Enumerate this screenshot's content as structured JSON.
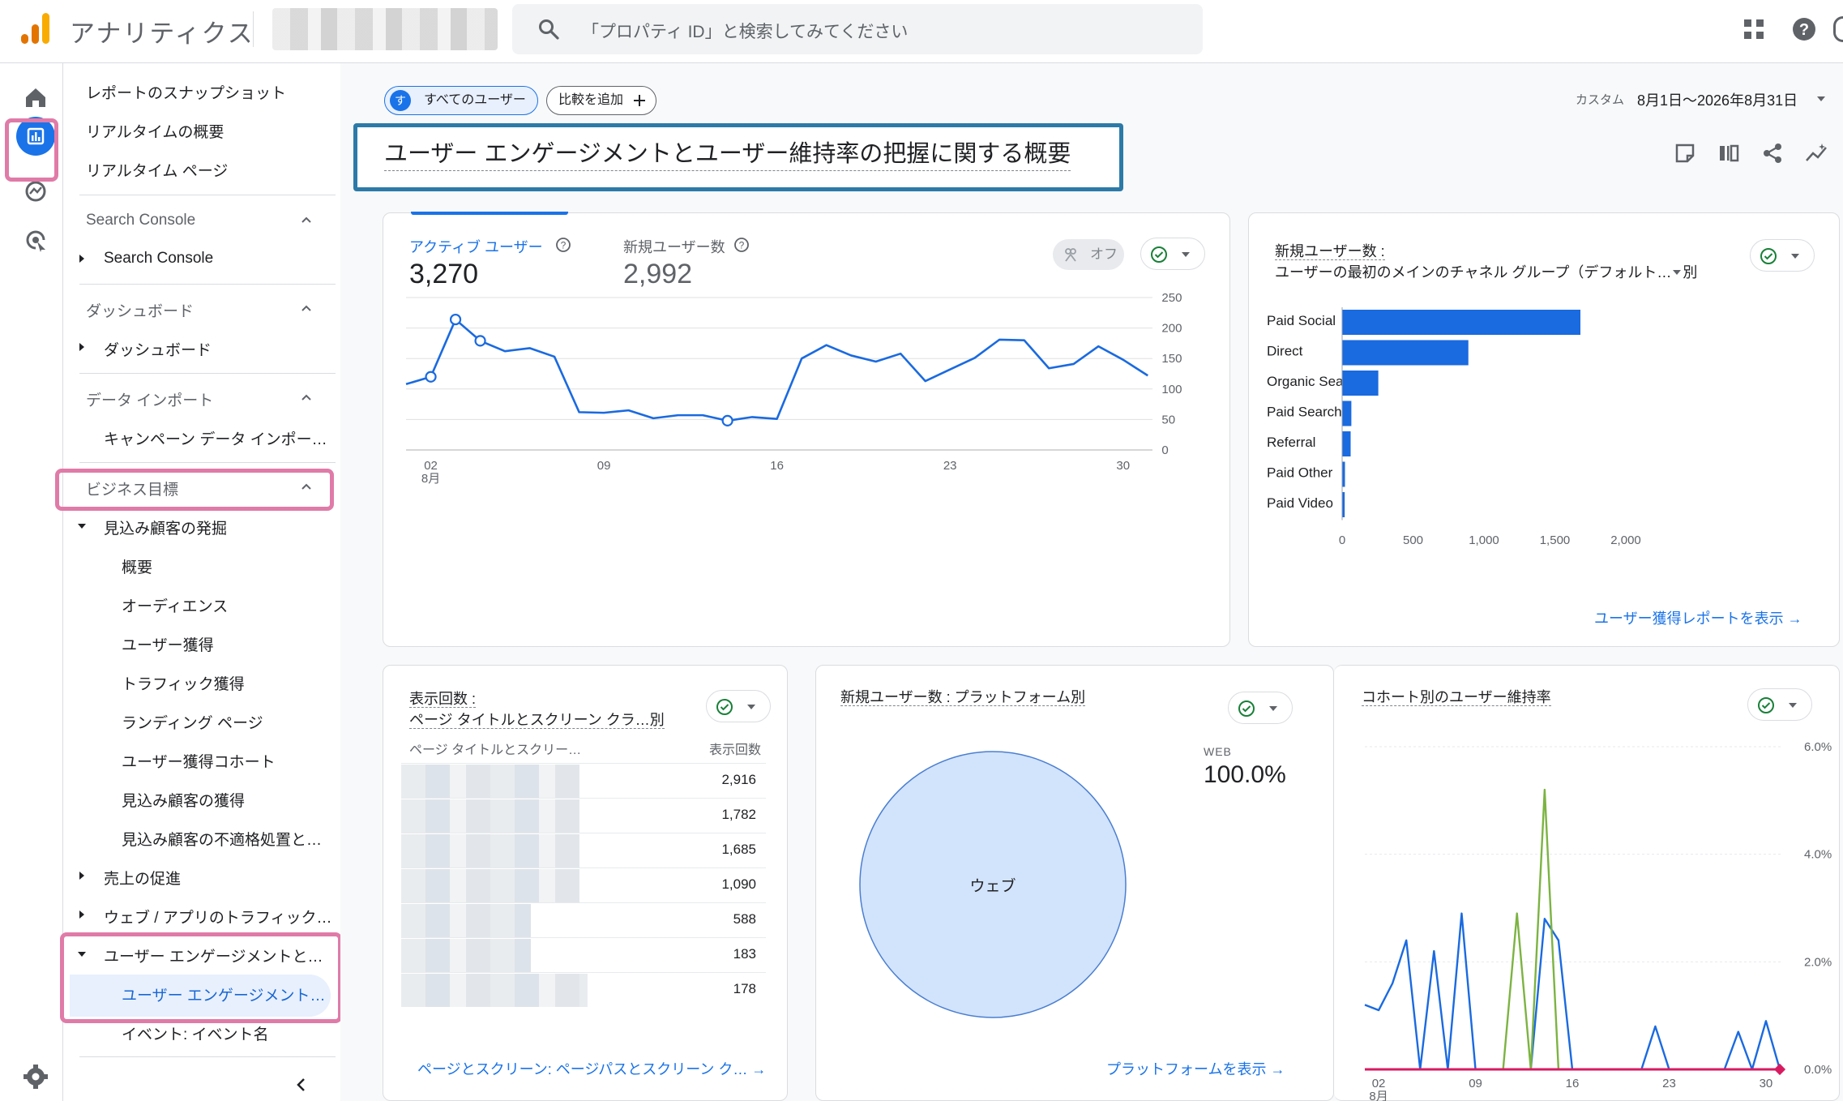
{
  "header": {
    "app_title": "アナリティクス",
    "search_placeholder": "「プロパティ ID」と検索してみてください"
  },
  "nav": {
    "top_items": [
      "レポートのスナップショット",
      "リアルタイムの概要",
      "リアルタイム ページ"
    ],
    "search_console_section": "Search Console",
    "search_console_item": "Search Console",
    "dashboard_section": "ダッシュボード",
    "dashboard_item": "ダッシュボード",
    "import_section": "データ インポート",
    "import_item": "キャンペーン データ インポー…",
    "business_section": "ビジネス目標",
    "leads_group": "見込み顧客の発掘",
    "leads_items": [
      "概要",
      "オーディエンス",
      "ユーザー獲得",
      "トラフィック獲得",
      "ランディング ページ",
      "ユーザー獲得コホート",
      "見込み顧客の獲得",
      "見込み顧客の不適格処置と…"
    ],
    "sales_group": "売上の促進",
    "traffic_group": "ウェブ / アプリのトラフィック…",
    "engagement_group": "ユーザー エンゲージメントと…",
    "engagement_active": "ユーザー エンゲージメント…",
    "events_item": "イベント: イベント名"
  },
  "toolbar": {
    "all_users_chip": "すべてのユーザー",
    "all_users_initial": "す",
    "compare_chip": "比較を追加",
    "date_label": "カスタム",
    "date_range": "8月1日～2026年8月31日"
  },
  "page_title": "ユーザー エンゲージメントとユーザー維持率の把握に関する概要",
  "card_active": {
    "metric1_label": "アクティブ ユーザー",
    "metric1_value": "3,270",
    "metric2_label": "新規ユーザー数",
    "metric2_value": "2,992",
    "off_label": "オフ",
    "x_ticks": [
      "02",
      "09",
      "16",
      "23",
      "30"
    ],
    "x_month": "8月",
    "y_ticks": [
      "250",
      "200",
      "150",
      "100",
      "50",
      "0"
    ]
  },
  "card_channel": {
    "title_line1": "新規ユーザー数 :",
    "title_line2": "ユーザーの最初のメインのチャネル グループ（デフォルト…",
    "title_suffix": "別",
    "x_ticks": [
      "0",
      "500",
      "1,000",
      "1,500",
      "2,000"
    ],
    "link": "ユーザー獲得レポートを表示"
  },
  "card_views": {
    "title_line1": "表示回数 :",
    "title_line2": "ページ タイトルとスクリーン クラ…別",
    "col1": "ページ タイトルとスクリー…",
    "col2": "表示回数",
    "rows": [
      "2,916",
      "1,782",
      "1,685",
      "1,090",
      "588",
      "183",
      "178"
    ],
    "link": "ページとスクリーン: ページパスとスクリーン ク…"
  },
  "card_platform": {
    "title": "新規ユーザー数 : プラットフォーム別",
    "legend_label": "WEB",
    "legend_value": "100.0%",
    "slice_label": "ウェブ",
    "link": "プラットフォームを表示"
  },
  "card_cohort": {
    "title": "コホート別のユーザー維持率",
    "y_ticks": [
      "6.0%",
      "4.0%",
      "2.0%",
      "0.0%"
    ],
    "x_ticks": [
      "02",
      "09",
      "16",
      "23",
      "30"
    ],
    "x_month": "8月"
  },
  "colors": {
    "accent": "#1a73e8",
    "bar": "#1a6ae0",
    "check": "#188038",
    "pink": "#d81b60",
    "green": "#7cb342",
    "highlight_box": "#2c7aa8"
  },
  "chart_data": [
    {
      "type": "line",
      "x": [
        "2026-08-01",
        "2026-08-02",
        "2026-08-03",
        "2026-08-04",
        "2026-08-05",
        "2026-08-06",
        "2026-08-07",
        "2026-08-08",
        "2026-08-09",
        "2026-08-10",
        "2026-08-11",
        "2026-08-12",
        "2026-08-13",
        "2026-08-14",
        "2026-08-15",
        "2026-08-16",
        "2026-08-17",
        "2026-08-18",
        "2026-08-19",
        "2026-08-20",
        "2026-08-21",
        "2026-08-22",
        "2026-08-23",
        "2026-08-24",
        "2026-08-25",
        "2026-08-26",
        "2026-08-27",
        "2026-08-28",
        "2026-08-29",
        "2026-08-30",
        "2026-08-31"
      ],
      "series": [
        {
          "values": [
            108,
            120,
            214,
            179,
            162,
            167,
            153,
            62,
            61,
            65,
            52,
            57,
            57,
            48,
            54,
            51,
            150,
            172,
            155,
            145,
            158,
            113,
            132,
            151,
            181,
            180,
            134,
            141,
            170,
            148,
            122
          ]
        }
      ],
      "markers": [
        1,
        2,
        3,
        13
      ],
      "ylim": [
        0,
        250
      ],
      "grid": true
    },
    {
      "type": "bar",
      "orientation": "horizontal",
      "categories": [
        "Paid Social",
        "Direct",
        "Organic Search",
        "Paid Search",
        "Referral",
        "Paid Other",
        "Paid Video"
      ],
      "values": [
        1680,
        890,
        255,
        65,
        60,
        20,
        18
      ],
      "xlim": [
        0,
        2000
      ]
    },
    {
      "type": "pie",
      "categories": [
        "ウェブ"
      ],
      "values": [
        100.0
      ]
    },
    {
      "type": "line",
      "x": [
        "2026-08-01",
        "2026-08-02",
        "2026-08-03",
        "2026-08-04",
        "2026-08-05",
        "2026-08-06",
        "2026-08-07",
        "2026-08-08",
        "2026-08-09",
        "2026-08-10",
        "2026-08-11",
        "2026-08-12",
        "2026-08-13",
        "2026-08-14",
        "2026-08-15",
        "2026-08-16",
        "2026-08-17",
        "2026-08-18",
        "2026-08-19",
        "2026-08-20",
        "2026-08-21",
        "2026-08-22",
        "2026-08-23",
        "2026-08-24",
        "2026-08-25",
        "2026-08-26",
        "2026-08-27",
        "2026-08-28",
        "2026-08-29",
        "2026-08-30",
        "2026-08-31"
      ],
      "series": [
        {
          "color": "#1a6ae0",
          "values": [
            1.2,
            1.1,
            1.6,
            2.4,
            0,
            2.2,
            0,
            2.9,
            0,
            0,
            0,
            0,
            0,
            2.8,
            2.4,
            0,
            0,
            0,
            0,
            0,
            0,
            0.8,
            0,
            0,
            0,
            0,
            0,
            0.7,
            0,
            0.9,
            0
          ]
        },
        {
          "color": "#7cb342",
          "values": [
            0,
            0,
            0,
            0,
            0,
            0,
            0,
            0,
            0,
            0,
            0,
            2.9,
            0,
            5.2,
            0,
            0,
            0,
            0,
            0,
            0,
            0,
            0,
            0,
            0,
            0,
            0,
            0,
            0,
            0,
            0,
            0
          ]
        },
        {
          "color": "#d81b60",
          "values": [
            0,
            0,
            0,
            0,
            0,
            0,
            0,
            0,
            0,
            0,
            0,
            0,
            0,
            0,
            0,
            0,
            0,
            0,
            0,
            0,
            0,
            0,
            0,
            0,
            0,
            0,
            0,
            0,
            0,
            0,
            0
          ]
        }
      ],
      "ylim": [
        0,
        6
      ]
    }
  ]
}
